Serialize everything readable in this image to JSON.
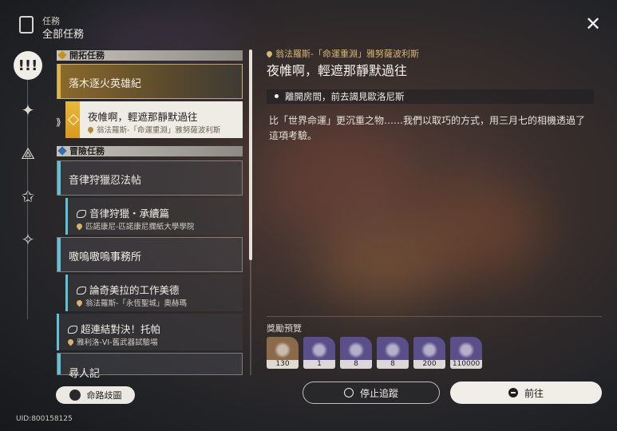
{
  "header": {
    "section": "任務",
    "title": "全部任務"
  },
  "rail": {
    "active": "exclamation-icon",
    "items": [
      "compass-star-icon",
      "triangle-star-icon",
      "star-icon",
      "diamond-star-icon"
    ]
  },
  "list": {
    "sections": [
      {
        "label": "開拓任務"
      },
      {
        "label": "冒險任務"
      }
    ],
    "items": [
      {
        "kind": "main",
        "title": "落木逐火英雄紀"
      },
      {
        "kind": "sub-selected",
        "title": "夜帷啊，輕遮那靜默過往",
        "location": "翁法羅斯-「命運重淵」雅努薩波利斯"
      },
      {
        "kind": "main",
        "title": "音律狩獵忍法帖"
      },
      {
        "kind": "sub",
        "title": "音律狩獵・承續篇",
        "location": "匹諾康尼-匹諾康尼攔紙大學學院"
      },
      {
        "kind": "main",
        "title": "嗷嗚嗷嗚事務所"
      },
      {
        "kind": "sub",
        "title": "論奇美拉的工作美德",
        "location": "翁法羅斯-「永恆聖城」奧赫瑪"
      },
      {
        "kind": "sub",
        "title": "超連結對決！托帕",
        "location": "雅利洛-VI-舊武器試驗場"
      },
      {
        "kind": "main",
        "title": "尋人記"
      }
    ]
  },
  "detail": {
    "location": "翁法羅斯-「命運重淵」雅努薩波利斯",
    "title": "夜帷啊，輕遮那靜默過往",
    "objective": "離開房間，前去謁見歐洛尼斯",
    "description": "比「世界命運」更沉重之物……我們以取巧的方式，用三月七的相機透過了這項考驗。",
    "rewards_label": "獎勵預覽",
    "rewards": [
      {
        "icon": "crystal-icon",
        "count": "130",
        "color": "#8a6a4a"
      },
      {
        "icon": "character-icon",
        "count": "1",
        "color": "#5b4f8a"
      },
      {
        "icon": "material-icon",
        "count": "8",
        "color": "#5b4f8a"
      },
      {
        "icon": "material-icon",
        "count": "8",
        "color": "#5b4f8a"
      },
      {
        "icon": "potion-icon",
        "count": "200",
        "color": "#5b4f8a"
      },
      {
        "icon": "exp-book-icon",
        "count": "110000",
        "color": "#5b4f8a"
      }
    ]
  },
  "buttons": {
    "stop": "停止追蹤",
    "go": "前往",
    "path": "命路歧圖"
  },
  "uid": "UID:800158125"
}
